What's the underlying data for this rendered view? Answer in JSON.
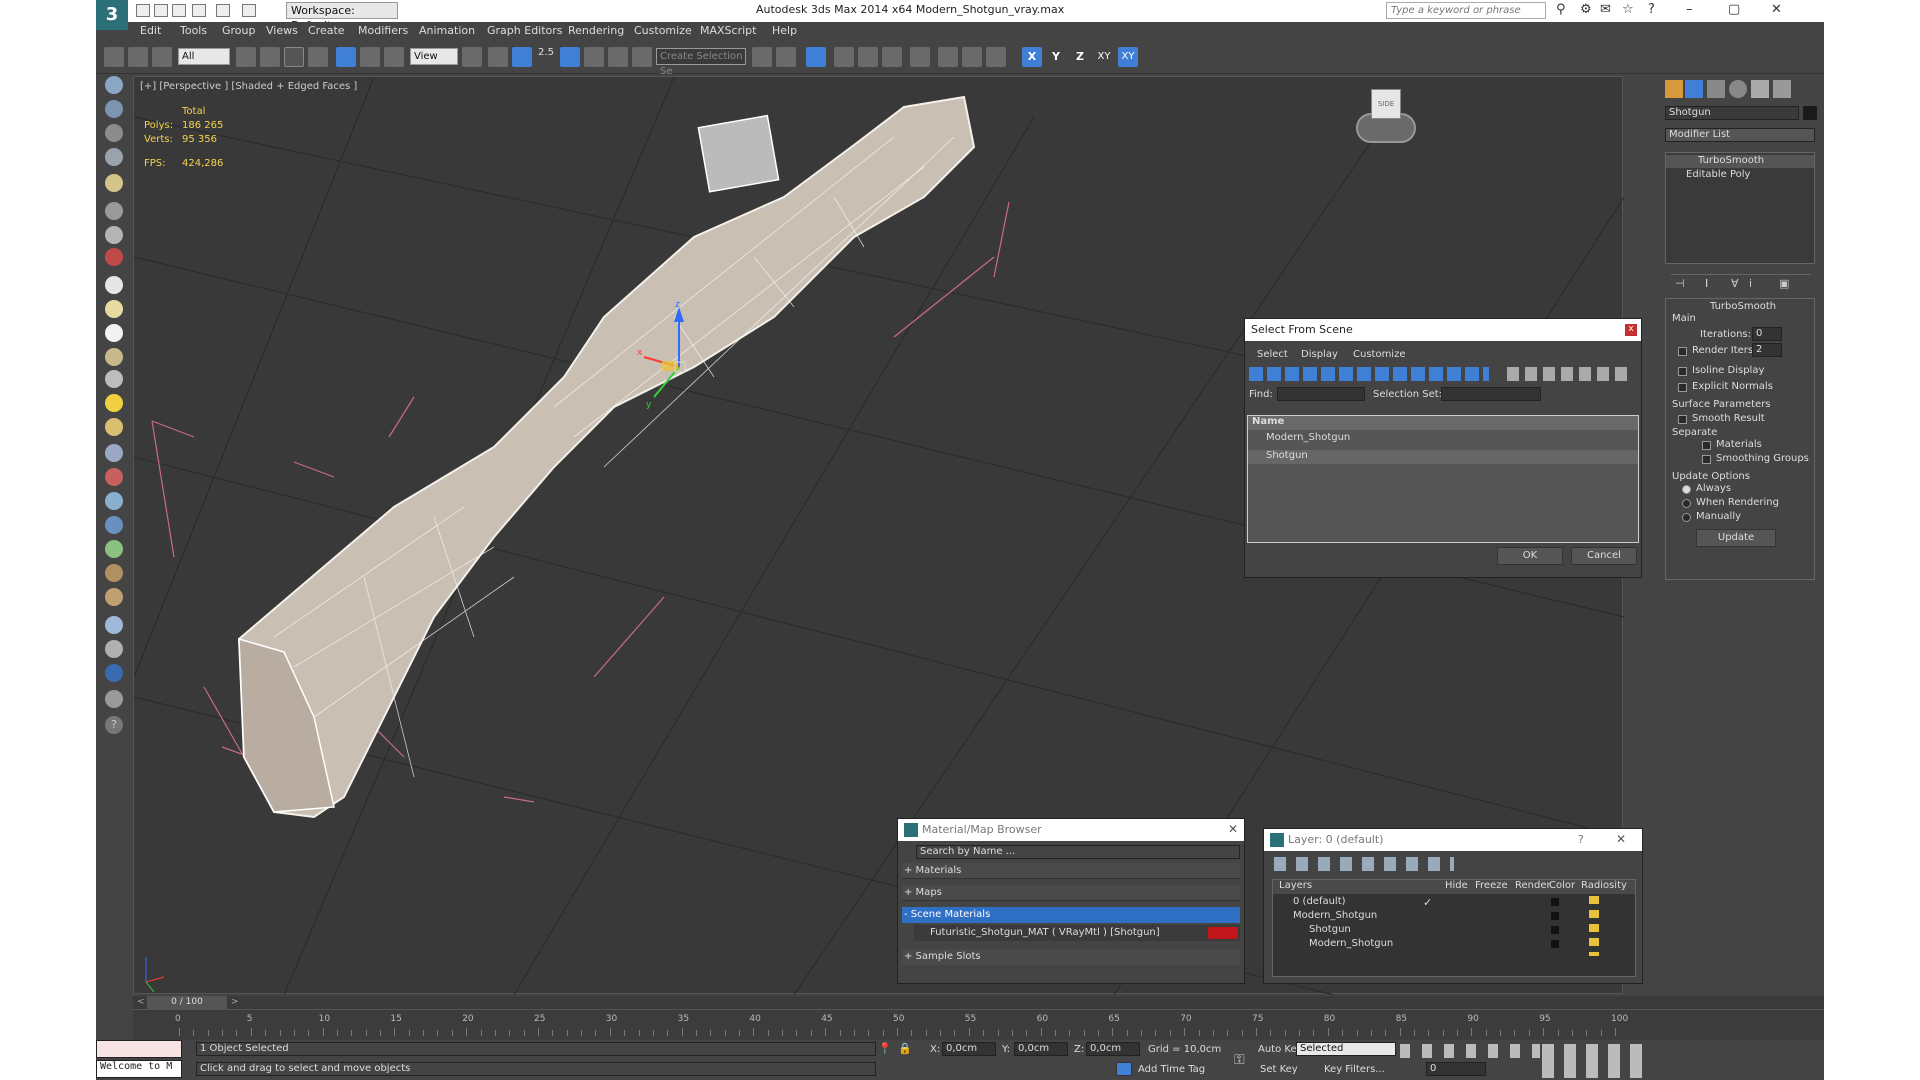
{
  "window": {
    "title": "Autodesk 3ds Max  2014 x64     Modern_Shotgun_vray.max",
    "workspace": "Workspace: Default",
    "search_placeholder": "Type a keyword or phrase"
  },
  "menus": [
    "Edit",
    "Tools",
    "Group",
    "Views",
    "Create",
    "Modifiers",
    "Animation",
    "Graph Editors",
    "Rendering",
    "Customize",
    "MAXScript",
    "Help"
  ],
  "toolbar": {
    "filter": "All",
    "ref_coord": "View",
    "snap_value": "2.5",
    "selection_set": "Create Selection Se",
    "axes": [
      "X",
      "Y",
      "Z",
      "XY",
      "XY"
    ]
  },
  "viewport": {
    "label": "[+] [Perspective ] [Shaded + Edged Faces ]",
    "stats": {
      "header": "Total",
      "polys_label": "Polys:",
      "polys": "186 265",
      "verts_label": "Verts:",
      "verts": "95 356",
      "fps_label": "FPS:",
      "fps": "424,286"
    },
    "viewcube": "SIDE",
    "gizmo": {
      "x": "x",
      "y": "y",
      "z": "z"
    }
  },
  "command_panel": {
    "object_name": "Shotgun",
    "modifier_list": "Modifier List",
    "stack": [
      "TurboSmooth",
      "Editable Poly"
    ],
    "turbosmooth": {
      "title": "TurboSmooth",
      "main": "Main",
      "iterations_label": "Iterations:",
      "iterations": "0",
      "render_iters_label": "Render Iters:",
      "render_iters": "2",
      "isoline": "Isoline Display",
      "explicit": "Explicit Normals",
      "surface_params": "Surface Parameters",
      "smooth_result": "Smooth Result",
      "separate": "Separate",
      "materials": "Materials",
      "smoothing_groups": "Smoothing Groups",
      "update_options": "Update Options",
      "always": "Always",
      "when_rendering": "When Rendering",
      "manually": "Manually",
      "update_btn": "Update"
    }
  },
  "select_dialog": {
    "title": "Select From Scene",
    "close": "x",
    "menus": [
      "Select",
      "Display",
      "Customize"
    ],
    "find_label": "Find:",
    "selection_set_label": "Selection Set:",
    "column_name": "Name",
    "items": [
      "Modern_Shotgun",
      "Shotgun"
    ],
    "ok": "OK",
    "cancel": "Cancel"
  },
  "material_browser": {
    "title": "Material/Map Browser",
    "search_placeholder": "Search by Name ...",
    "groups": [
      "+ Materials",
      "+ Maps",
      "- Scene Materials",
      "+ Sample Slots"
    ],
    "scene_material": "Futuristic_Shotgun_MAT ( VRayMtl ) [Shotgun]",
    "swatch_color": "#c0161b"
  },
  "layer_dialog": {
    "title": "Layer: 0 (default)",
    "help": "?",
    "columns": [
      "Layers",
      "Hide",
      "Freeze",
      "Render",
      "Color",
      "Radiosity"
    ],
    "rows": [
      "0 (default)",
      "Modern_Shotgun",
      "Shotgun",
      "Modern_Shotgun"
    ]
  },
  "timeline": {
    "frame": "0 / 100",
    "ticks": [
      "0",
      "5",
      "10",
      "15",
      "20",
      "25",
      "30",
      "35",
      "40",
      "45",
      "50",
      "55",
      "60",
      "65",
      "70",
      "75",
      "80",
      "85",
      "90",
      "95",
      "100"
    ]
  },
  "status": {
    "selected": "1 Object Selected",
    "prompt": "Click and drag to select and move objects",
    "script": "Welcome to M",
    "x_label": "X:",
    "x": "0,0cm",
    "y_label": "Y:",
    "y": "0,0cm",
    "z_label": "Z:",
    "z": "0,0cm",
    "grid": "Grid = 10,0cm",
    "auto_key": "Auto Key",
    "key_mode": "Selected",
    "set_key": "Set Key",
    "key_filters": "Key Filters...",
    "add_time_tag": "Add Time Tag",
    "frame_field": "0"
  }
}
